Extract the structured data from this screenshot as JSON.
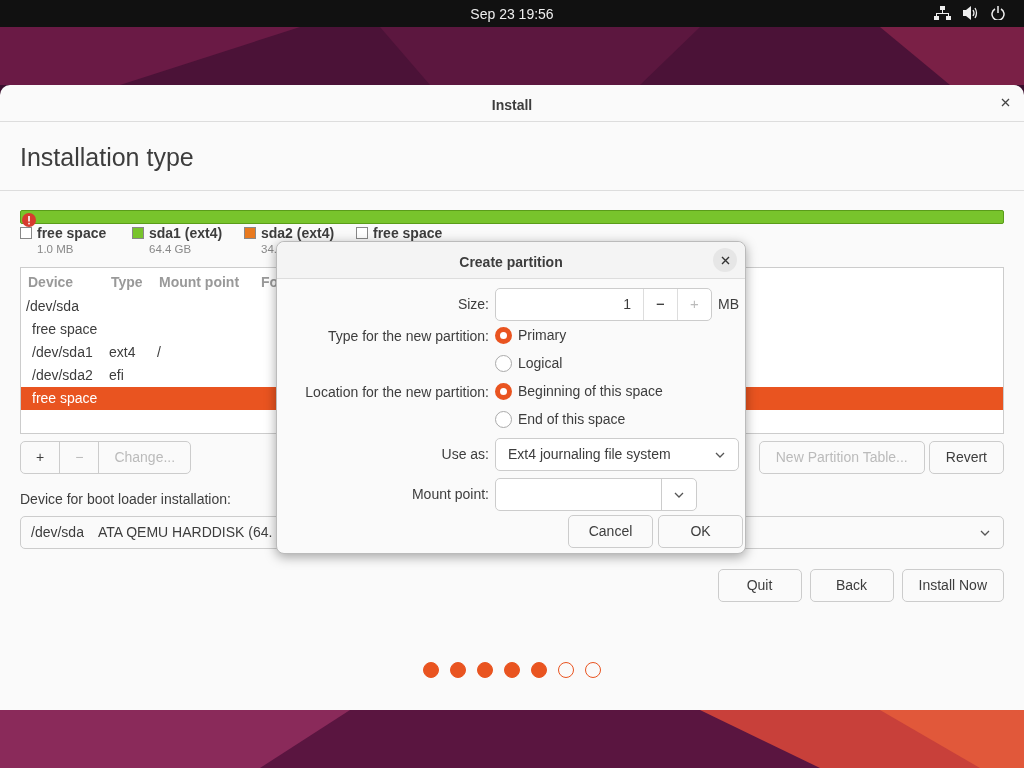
{
  "top_bar": {
    "clock": "Sep 23  19:56"
  },
  "window": {
    "title": "Install",
    "heading": "Installation type"
  },
  "legend": [
    {
      "label": "free space",
      "size": "1.0 MB",
      "color": "#ffffff"
    },
    {
      "label": "sda1 (ext4)",
      "size": "64.4 GB",
      "color": "#78c42c"
    },
    {
      "label": "sda2 (ext4)",
      "size": "34.",
      "color": "#e8791e"
    },
    {
      "label": "free space",
      "color": "#ffffff"
    }
  ],
  "table": {
    "columns": [
      "Device",
      "Type",
      "Mount point",
      "Fo"
    ],
    "rows": [
      {
        "device": "/dev/sda",
        "selected": false,
        "children": [
          {
            "device": "free space",
            "selected": false
          },
          {
            "device": "/dev/sda1",
            "type": "ext4",
            "mount_point": "/",
            "selected": false
          },
          {
            "device": "/dev/sda2",
            "type": "efi",
            "selected": false
          },
          {
            "device": "free space",
            "selected": true
          }
        ]
      }
    ]
  },
  "partition_buttons": [
    {
      "label": "+",
      "disabled": false
    },
    {
      "label": "−",
      "disabled": true
    },
    {
      "label": "Change...",
      "disabled": true
    }
  ],
  "table_buttons": [
    {
      "label": "New Partition Table...",
      "disabled": true
    },
    {
      "label": "Revert",
      "disabled": false
    }
  ],
  "boot_loader": {
    "label": "Device for boot loader installation:",
    "device": "/dev/sda",
    "description": "ATA QEMU HARDDISK (64."
  },
  "nav_buttons": [
    "Quit",
    "Back",
    "Install Now"
  ],
  "progress_dots": [
    {
      "filled": true
    },
    {
      "filled": true
    },
    {
      "filled": true
    },
    {
      "filled": true
    },
    {
      "filled": true
    },
    {
      "filled": false
    },
    {
      "filled": false
    }
  ],
  "dialog": {
    "title": "Create partition",
    "size": {
      "label": "Size:",
      "value": "1",
      "unit": "MB",
      "minus": "−",
      "minus_disabled": false,
      "plus": "+",
      "plus_disabled": true
    },
    "radio_groups": [
      {
        "label": "Type for the new partition:",
        "options": [
          {
            "label": "Primary",
            "selected": true
          },
          {
            "label": "Logical",
            "selected": false
          }
        ]
      },
      {
        "label": "Location for the new partition:",
        "options": [
          {
            "label": "Beginning of this space",
            "selected": true
          },
          {
            "label": "End of this space",
            "selected": false
          }
        ]
      }
    ],
    "use_as": {
      "label": "Use as:",
      "value": "Ext4 journaling file system"
    },
    "mount_point": {
      "label": "Mount point:"
    },
    "buttons": [
      "Cancel",
      "OK"
    ]
  }
}
